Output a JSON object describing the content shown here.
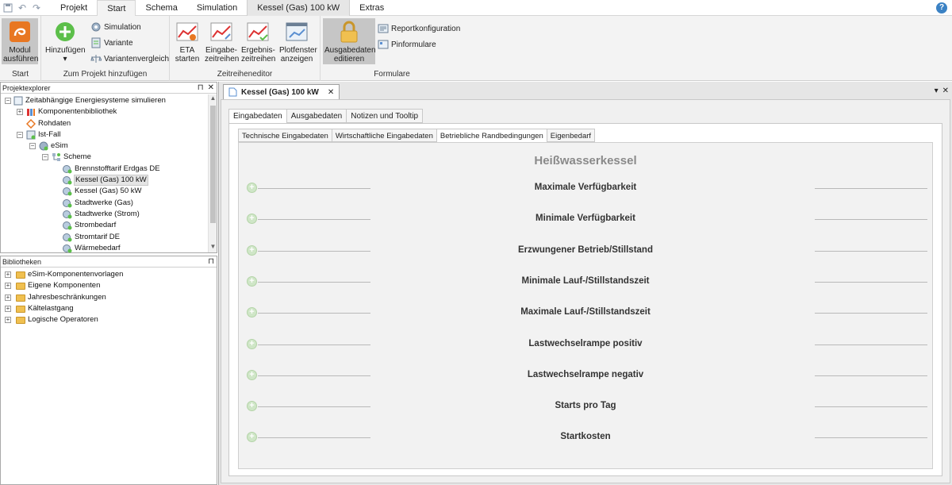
{
  "topbar": {
    "tabs": [
      {
        "label": "Projekt"
      },
      {
        "label": "Start"
      },
      {
        "label": "Schema"
      },
      {
        "label": "Simulation"
      },
      {
        "label": "Kessel (Gas) 100 kW"
      },
      {
        "label": "Extras"
      }
    ],
    "help": "?"
  },
  "ribbon": {
    "start": {
      "label": "Start",
      "modul": "Modul ausführen"
    },
    "projekt": {
      "label": "Zum Projekt hinzufügen",
      "hinzufuegen": "Hinzufügen",
      "simulation": "Simulation",
      "variante": "Variante",
      "variantenvergleich": "Variantenvergleich"
    },
    "zeitreihe": {
      "label": "Zeitreiheneditor",
      "eta": "ETA starten",
      "eingabe": "Eingabe-zeitreihen",
      "ergebnis": "Ergebnis-zeitreihen",
      "plot": "Plotfenster anzeigen"
    },
    "formulare": {
      "label": "Formulare",
      "ausgabe": "Ausgabedaten editieren",
      "report": "Reportkonfiguration",
      "pin": "Pinformulare"
    }
  },
  "projektexplorer": {
    "title": "Projektexplorer",
    "items": [
      {
        "label": "Zeitabhängige Energiesysteme simulieren"
      },
      {
        "label": "Komponentenbibliothek"
      },
      {
        "label": "Rohdaten"
      },
      {
        "label": "Ist-Fall"
      },
      {
        "label": "eSim"
      },
      {
        "label": "Scheme"
      },
      {
        "label": "Brennstofftarif Erdgas DE"
      },
      {
        "label": "Kessel (Gas) 100 kW"
      },
      {
        "label": "Kessel (Gas) 50 kW"
      },
      {
        "label": "Stadtwerke (Gas)"
      },
      {
        "label": "Stadtwerke (Strom)"
      },
      {
        "label": "Strombedarf"
      },
      {
        "label": "Stromtarif DE"
      },
      {
        "label": "Wärmebedarf"
      }
    ]
  },
  "bibliotheken": {
    "title": "Bibliotheken",
    "items": [
      {
        "label": "eSim-Komponentenvorlagen"
      },
      {
        "label": "Eigene Komponenten"
      },
      {
        "label": "Jahresbeschränkungen"
      },
      {
        "label": "Kältelastgang"
      },
      {
        "label": "Logische Operatoren"
      }
    ]
  },
  "document": {
    "tab_title": "Kessel (Gas) 100 kW",
    "tabs": [
      {
        "label": "Eingabedaten"
      },
      {
        "label": "Ausgabedaten"
      },
      {
        "label": "Notizen und Tooltip"
      }
    ],
    "subtabs": [
      {
        "label": "Technische Eingabedaten"
      },
      {
        "label": "Wirtschaftliche Eingabedaten"
      },
      {
        "label": "Betriebliche Randbedingungen"
      },
      {
        "label": "Eigenbedarf"
      }
    ],
    "heading": "Heißwasserkessel",
    "sections": [
      {
        "label": "Maximale Verfügbarkeit"
      },
      {
        "label": "Minimale Verfügbarkeit"
      },
      {
        "label": "Erzwungener Betrieb/Stillstand"
      },
      {
        "label": "Minimale Lauf-/Stillstandszeit"
      },
      {
        "label": "Maximale Lauf-/Stillstandszeit"
      },
      {
        "label": "Lastwechselrampe positiv"
      },
      {
        "label": "Lastwechselrampe negativ"
      },
      {
        "label": "Starts pro Tag"
      },
      {
        "label": "Startkosten"
      }
    ]
  },
  "colors": {
    "accent": "#e87722",
    "ribbon_bg": "#f3f3f3",
    "plus": "#cfe6c7"
  }
}
